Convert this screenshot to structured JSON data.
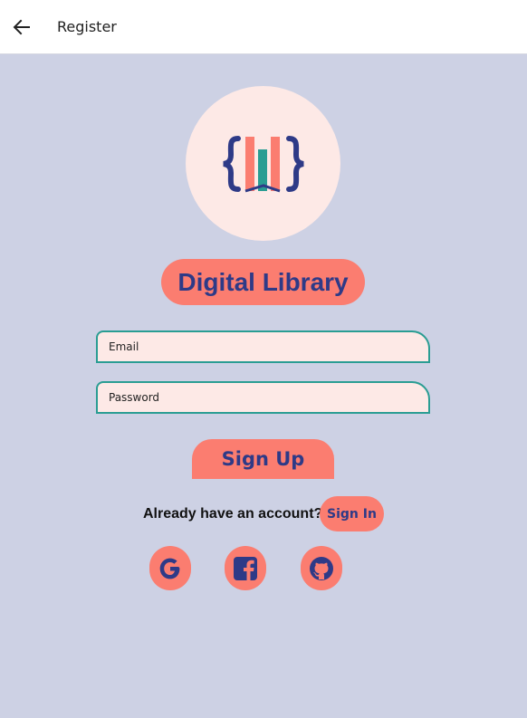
{
  "header": {
    "back_icon": "arrow-left-icon",
    "title": "Register"
  },
  "logo": {
    "icon": "books-in-braces-icon",
    "colors": {
      "brace": "#2e3a87",
      "book_coral": "#fb7d70",
      "book_teal": "#2a9d93"
    }
  },
  "app_title": "Digital Library",
  "form": {
    "email_placeholder": "Email",
    "password_placeholder": "Password",
    "signup_label": "Sign Up"
  },
  "signin_prompt": {
    "text": "Already have an account?",
    "button_label": "Sign In"
  },
  "social": [
    {
      "name": "google",
      "icon": "google-icon"
    },
    {
      "name": "facebook",
      "icon": "facebook-icon"
    },
    {
      "name": "github",
      "icon": "github-icon"
    }
  ],
  "colors": {
    "background": "#cdd1e4",
    "accent": "#fb7d70",
    "primary_text": "#2e3a87",
    "field_border": "#2a9d93",
    "field_fill": "#fde9e6"
  }
}
